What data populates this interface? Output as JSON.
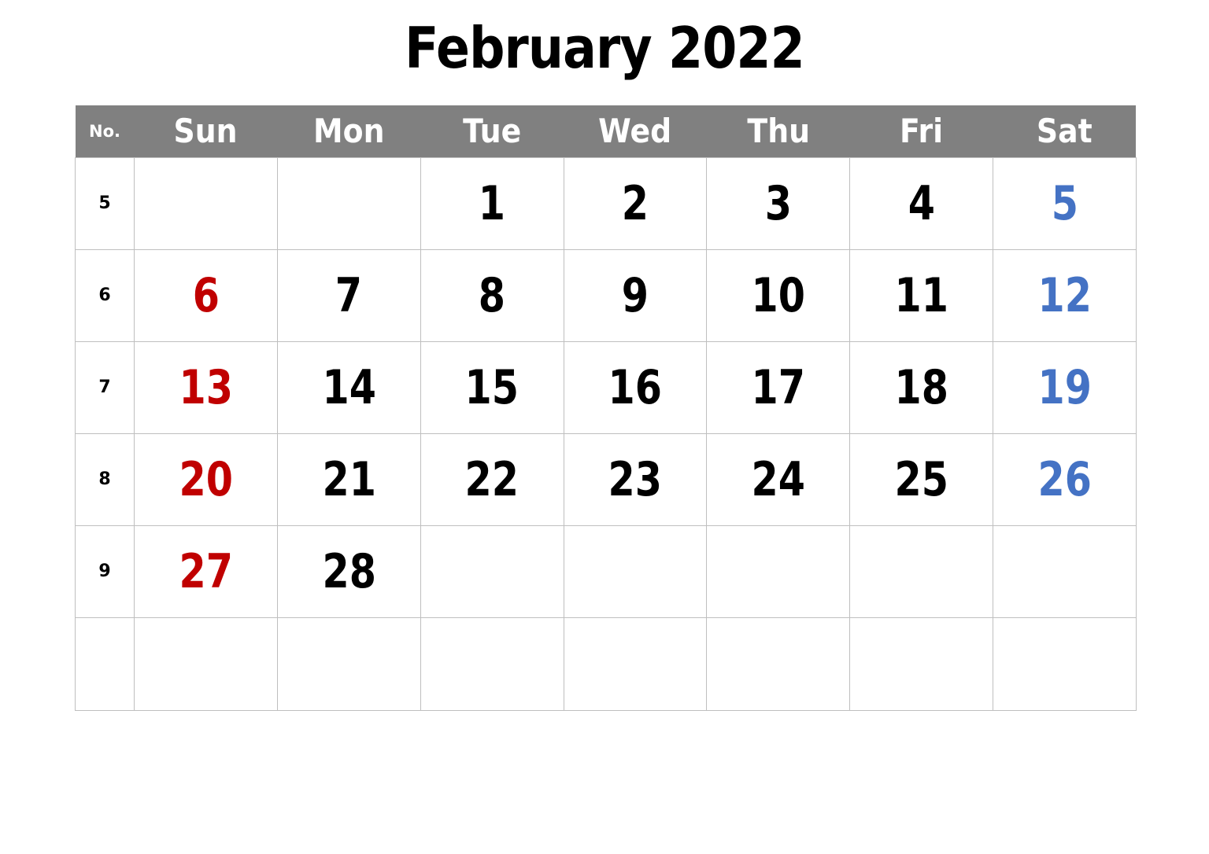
{
  "title": "February 2022",
  "header": {
    "week_number_label": "No.",
    "weekdays": [
      "Sun",
      "Mon",
      "Tue",
      "Wed",
      "Thu",
      "Fri",
      "Sat"
    ],
    "background_color": "#808080",
    "text_color": "#FFFFFF"
  },
  "colors": {
    "sunday": "#C00000",
    "saturday": "#4472C4",
    "weekday": "#000000",
    "header_gray": "#808080",
    "grid_line": "#BFBFBF",
    "page_background": "#FFFFFF"
  },
  "weeks": [
    {
      "week_number": "5",
      "days": [
        "",
        "",
        "1",
        "2",
        "3",
        "4",
        "5"
      ]
    },
    {
      "week_number": "6",
      "days": [
        "6",
        "7",
        "8",
        "9",
        "10",
        "11",
        "12"
      ]
    },
    {
      "week_number": "7",
      "days": [
        "13",
        "14",
        "15",
        "16",
        "17",
        "18",
        "19"
      ]
    },
    {
      "week_number": "8",
      "days": [
        "20",
        "21",
        "22",
        "23",
        "24",
        "25",
        "26"
      ]
    },
    {
      "week_number": "9",
      "days": [
        "27",
        "28",
        "",
        "",
        "",
        "",
        ""
      ]
    },
    {
      "week_number": "",
      "days": [
        "",
        "",
        "",
        "",
        "",
        "",
        ""
      ]
    }
  ]
}
